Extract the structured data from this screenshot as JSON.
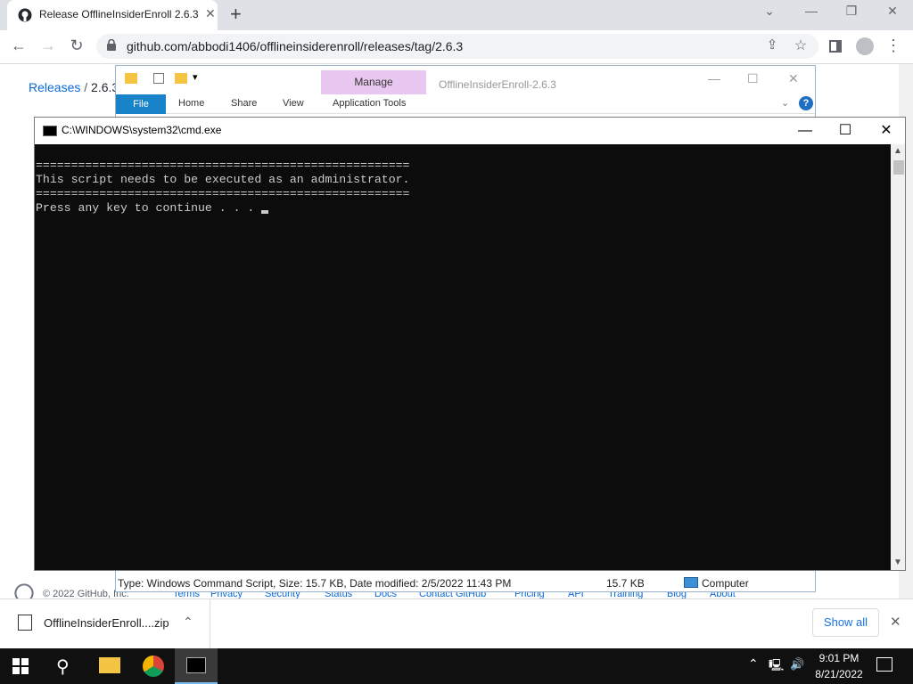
{
  "browser": {
    "tab_title": "Release OfflineInsiderEnroll 2.6.3",
    "url": "github.com/abbodi1406/offlineinsiderenroll/releases/tag/2.6.3"
  },
  "github": {
    "crumb_releases": "Releases",
    "crumb_sep": "/",
    "crumb_version": "2.6.3",
    "footer_items": [
      "© 2022 GitHub, Inc.",
      "Terms",
      "Privacy",
      "Security",
      "Status",
      "Docs",
      "Contact GitHub",
      "Pricing",
      "API",
      "Training",
      "Blog",
      "About"
    ]
  },
  "explorer": {
    "title": "OfflineInsiderEnroll-2.6.3",
    "manage": "Manage",
    "tabs": [
      "File",
      "Home",
      "Share",
      "View",
      "Application Tools"
    ],
    "status_info": "Type: Windows Command Script, Size: 15.7 KB, Date modified: 2/5/2022 11:43 PM",
    "status_size": "15.7 KB",
    "status_location": "Computer"
  },
  "cmd": {
    "title": "C:\\WINDOWS\\system32\\cmd.exe",
    "line1": "=====================================================",
    "line2": "This script needs to be executed as an administrator.",
    "line3": "=====================================================",
    "line4": "",
    "line5": "Press any key to continue . . . "
  },
  "downloads": {
    "file": "OfflineInsiderEnroll....zip",
    "show_all": "Show all"
  },
  "taskbar": {
    "time": "9:01 PM",
    "date": "8/21/2022"
  },
  "colors": {
    "cmd_bg": "#0c0c0c",
    "cmd_text": "#cccccc",
    "link": "#0969da",
    "manage_tab": "#e8c8f0",
    "file_tab": "#1983c9",
    "taskbar": "#101010"
  }
}
